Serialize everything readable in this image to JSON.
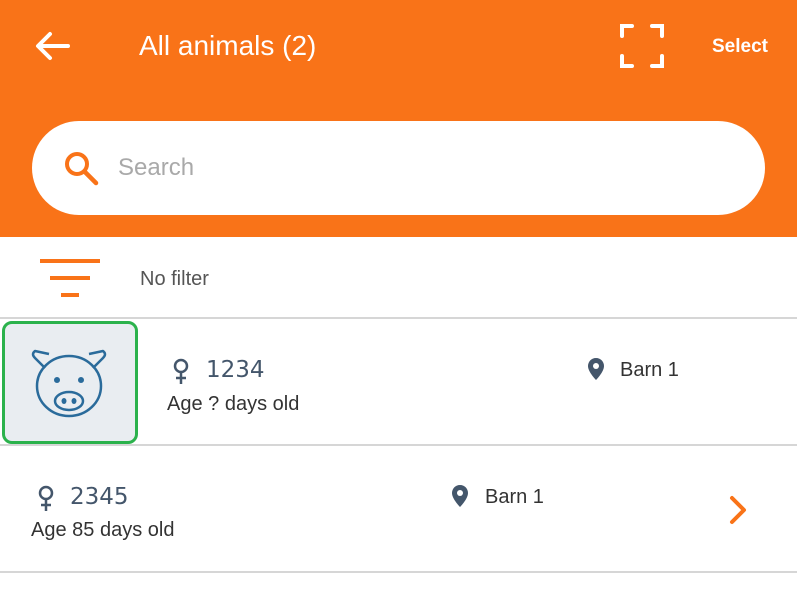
{
  "header": {
    "title": "All animals (2)",
    "select_label": "Select",
    "background_color": "#f97318"
  },
  "search": {
    "placeholder": "Search",
    "value": ""
  },
  "filter": {
    "label": "No filter",
    "icon_color": "#f97318"
  },
  "animals": [
    {
      "id": "1234",
      "sex_icon": "female-icon",
      "age_text": "Age ? days old",
      "location": "Barn 1",
      "selected": true,
      "avatar_icon": "pig-icon"
    },
    {
      "id": "2345",
      "sex_icon": "female-icon",
      "age_text": "Age 85 days old",
      "location": "Barn 1",
      "selected": false
    }
  ],
  "colors": {
    "accent": "#f97318",
    "selection_border": "#2bb24c",
    "icon_blue": "#44566b"
  }
}
